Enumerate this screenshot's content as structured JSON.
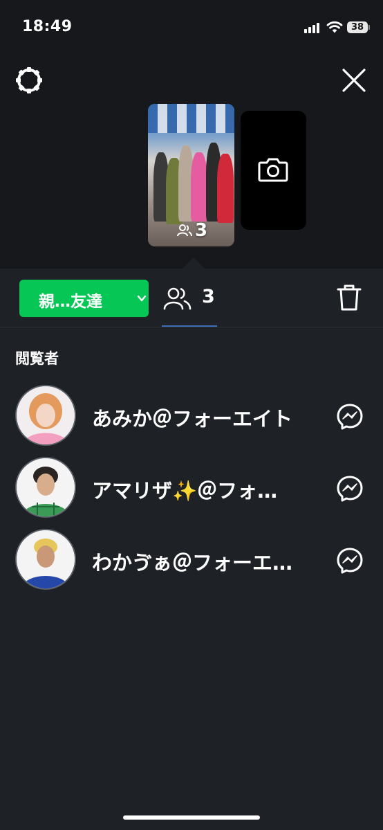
{
  "status_bar": {
    "time": "18:49",
    "battery": "38"
  },
  "story_preview": {
    "views_count": "3"
  },
  "toolbar": {
    "audience_label": "親…友達",
    "viewers_count": "3"
  },
  "viewers": {
    "title": "閲覧者",
    "items": [
      {
        "name": "あみか＠フォーエイト"
      },
      {
        "name": "アマリザ✨＠フォ…"
      },
      {
        "name": "わかゔぁ＠フォーエ…"
      }
    ]
  },
  "colors": {
    "accent_green": "#06c755",
    "background": "#1e2126",
    "tab_underline": "#3e6eb8"
  }
}
